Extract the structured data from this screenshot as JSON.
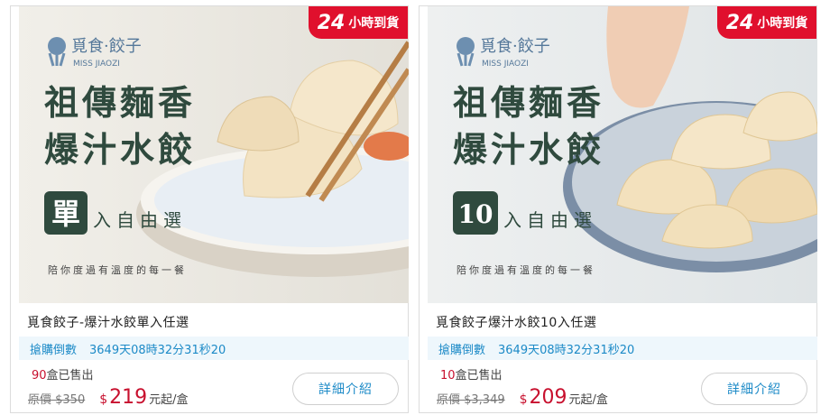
{
  "products": [
    {
      "badge_num": "24",
      "badge_text": "小時到貨",
      "logo_cn": "覓食·餃子",
      "logo_en": "MISS JIAOZI",
      "banner_line1": "祖傳麵香",
      "banner_line2": "爆汁水餃",
      "banner_tag_big": "單",
      "banner_tag_rest": "入自由選",
      "banner_slogan": "陪你度過有溫度的每一餐",
      "title": "覓食餃子-爆汁水餃單入任選",
      "countdown_label": "搶購倒數",
      "countdown_value": "3649天08時32分31秒20",
      "sold_count": "90",
      "sold_suffix": "盒已售出",
      "orig_price": "原價 $350",
      "currency": "$",
      "price": "219",
      "price_unit": "元起/盒",
      "button_label": "詳細介紹"
    },
    {
      "badge_num": "24",
      "badge_text": "小時到貨",
      "logo_cn": "覓食·餃子",
      "logo_en": "MISS JIAOZI",
      "banner_line1": "祖傳麵香",
      "banner_line2": "爆汁水餃",
      "banner_tag_big": "10",
      "banner_tag_rest": "入自由選",
      "banner_slogan": "陪你度過有溫度的每一餐",
      "title": "覓食餃子爆汁水餃10入任選",
      "countdown_label": "搶購倒數",
      "countdown_value": "3649天08時32分31秒20",
      "sold_count": "10",
      "sold_suffix": "盒已售出",
      "orig_price": "原價 $3,349",
      "currency": "$",
      "price": "209",
      "price_unit": "元起/盒",
      "button_label": "詳細介紹"
    }
  ],
  "colors": {
    "accent_red": "#e0102d",
    "link_blue": "#1c8ac7",
    "countdown_bg": "#eef7fc",
    "banner_green": "#2f4a3e"
  }
}
